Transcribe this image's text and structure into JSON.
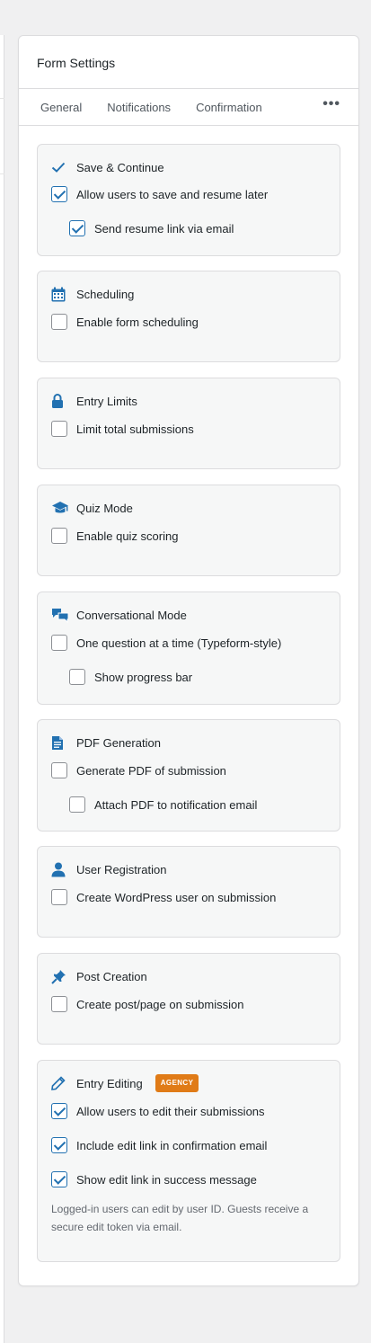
{
  "panel": {
    "title": "Form Settings",
    "tabs": [
      {
        "label": "General"
      },
      {
        "label": "Notifications"
      },
      {
        "label": "Confirmation"
      }
    ],
    "more_label": "•••"
  },
  "sections": {
    "save_continue": {
      "title": "Save & Continue",
      "icon": "check-icon",
      "options": [
        {
          "label": "Allow users to save and resume later",
          "checked": true
        },
        {
          "label": "Send resume link via email",
          "checked": true
        }
      ]
    },
    "scheduling": {
      "title": "Scheduling",
      "icon": "calendar-icon",
      "options": [
        {
          "label": "Enable form scheduling",
          "checked": false
        }
      ]
    },
    "entry_limits": {
      "title": "Entry Limits",
      "icon": "lock-icon",
      "options": [
        {
          "label": "Limit total submissions",
          "checked": false
        }
      ]
    },
    "quiz_mode": {
      "title": "Quiz Mode",
      "icon": "graduation-cap-icon",
      "options": [
        {
          "label": "Enable quiz scoring",
          "checked": false
        }
      ]
    },
    "conversational": {
      "title": "Conversational Mode",
      "icon": "chat-bubbles-icon",
      "options": [
        {
          "label": "One question at a time (Typeform-style)",
          "checked": false
        },
        {
          "label": "Show progress bar",
          "checked": false
        }
      ]
    },
    "pdf": {
      "title": "PDF Generation",
      "icon": "document-icon",
      "options": [
        {
          "label": "Generate PDF of submission",
          "checked": false
        },
        {
          "label": "Attach PDF to notification email",
          "checked": false
        }
      ]
    },
    "user_registration": {
      "title": "User Registration",
      "icon": "user-icon",
      "options": [
        {
          "label": "Create WordPress user on submission",
          "checked": false
        }
      ]
    },
    "post_creation": {
      "title": "Post Creation",
      "icon": "pin-icon",
      "options": [
        {
          "label": "Create post/page on submission",
          "checked": false
        }
      ]
    },
    "entry_editing": {
      "title": "Entry Editing",
      "icon": "pencil-icon",
      "badge": "AGENCY",
      "options": [
        {
          "label": "Allow users to edit their submissions",
          "checked": true
        },
        {
          "label": "Include edit link in confirmation email",
          "checked": true
        },
        {
          "label": "Show edit link in success message",
          "checked": true
        }
      ],
      "note": "Logged-in users can edit by user ID. Guests receive a secure edit token via email."
    }
  },
  "colors": {
    "accent": "#2271b1",
    "badge": "#e07b17",
    "card_bg": "#f6f7f7",
    "page_bg": "#f0f0f1"
  }
}
